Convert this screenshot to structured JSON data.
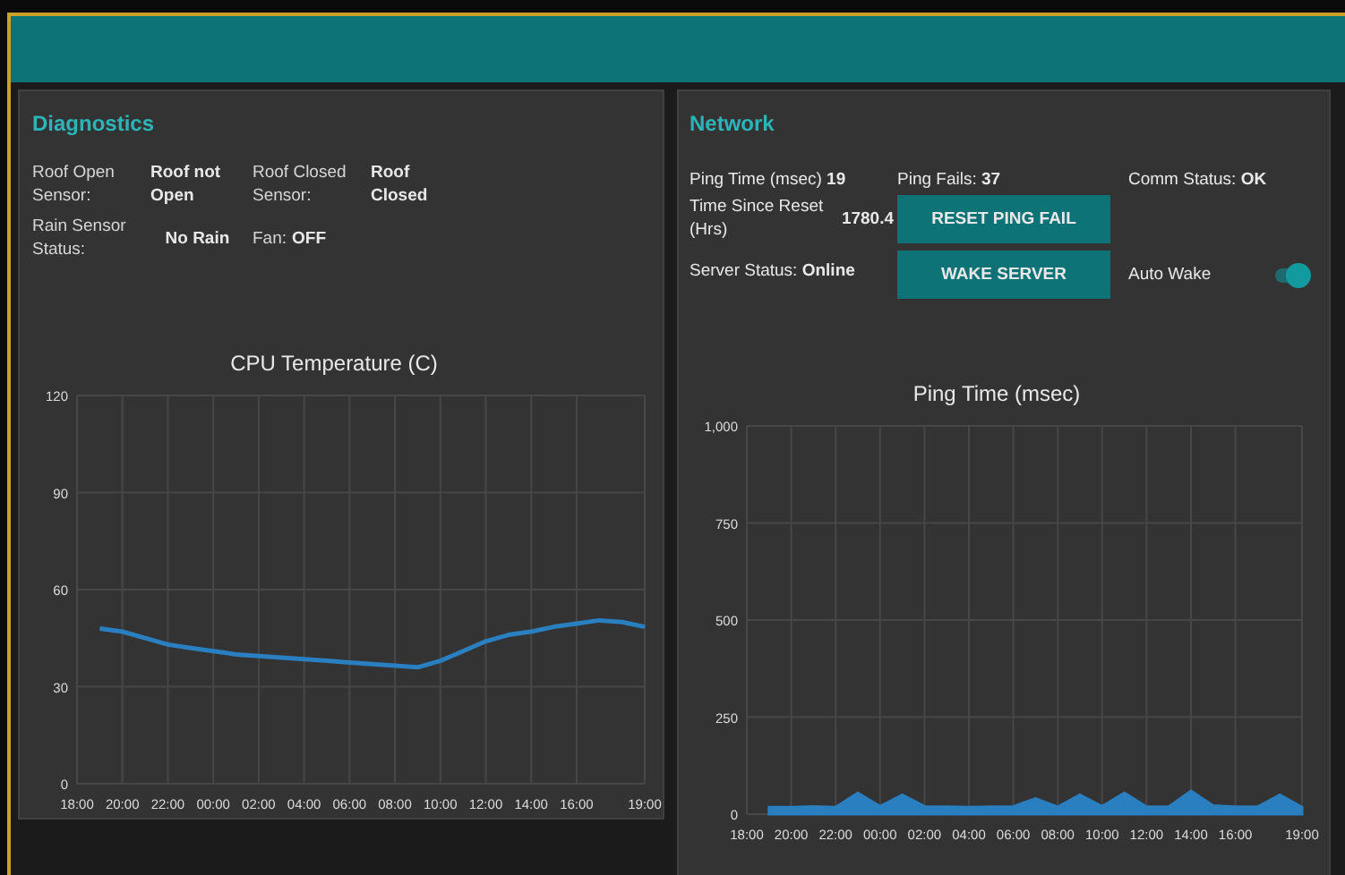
{
  "diagnostics": {
    "title": "Diagnostics",
    "fields": [
      {
        "label": "Roof Open Sensor:",
        "value": "Roof not Open"
      },
      {
        "label": "Roof Closed Sensor:",
        "value": "Roof Closed"
      },
      {
        "label": "Rain Sensor Status:",
        "value": "No Rain"
      },
      {
        "label": "Fan:",
        "value": "OFF"
      }
    ],
    "chart": {
      "chart_data": {
        "type": "line",
        "title": "CPU Temperature (C)",
        "categories": [
          "18:00",
          null,
          "20:00",
          null,
          "22:00",
          null,
          "00:00",
          null,
          "02:00",
          null,
          "04:00",
          null,
          "06:00",
          null,
          "08:00",
          null,
          "10:00",
          null,
          "12:00",
          null,
          "14:00",
          null,
          "16:00",
          null,
          null,
          "19:00"
        ],
        "series": [
          {
            "color": "#2a7fc0",
            "values": [
              null,
              48,
              47,
              45,
              43,
              42,
              41,
              40,
              39.5,
              39,
              38.5,
              38,
              37.5,
              37,
              36.5,
              36,
              38,
              41,
              44,
              46,
              47,
              48.5,
              49.5,
              50.5,
              50,
              48.5
            ]
          }
        ],
        "ylim": [
          0,
          120
        ],
        "grid": true,
        "yticks": [
          0,
          30,
          60,
          90,
          120
        ]
      }
    }
  },
  "network": {
    "title": "Network",
    "stats": [
      "Ping Time (msec) **19**",
      "Ping Fails: **37**",
      "Comm Status: **OK**"
    ],
    "reset": {
      "label": "Time Since Reset (Hrs)",
      "value": "1780.4"
    },
    "server_status": "Server Status: **Online**",
    "buttons": [
      "RESET PING FAIL",
      "WAKE SERVER"
    ],
    "auto_wake": {
      "label": "Auto Wake",
      "on": true
    },
    "chart": {
      "chart_data": {
        "type": "area",
        "title": "Ping Time (msec)",
        "categories": [
          "18:00",
          null,
          "20:00",
          null,
          "22:00",
          null,
          "00:00",
          null,
          "02:00",
          null,
          "04:00",
          null,
          "06:00",
          null,
          "08:00",
          null,
          "10:00",
          null,
          "12:00",
          null,
          "14:00",
          null,
          "16:00",
          null,
          null,
          "19:00"
        ],
        "series": [
          {
            "color": "#2a7fc0",
            "values": [
              null,
              18,
              18,
              20,
              18,
              55,
              20,
              50,
              20,
              19,
              18,
              19,
              20,
              40,
              19,
              50,
              20,
              55,
              19,
              19,
              60,
              22,
              19,
              19,
              50,
              18
            ]
          }
        ],
        "ylim": [
          0,
          1000
        ],
        "grid": true,
        "yticks": [
          0,
          250,
          500,
          750,
          {
            "value": 1000,
            "label": "1,000"
          }
        ]
      }
    }
  }
}
